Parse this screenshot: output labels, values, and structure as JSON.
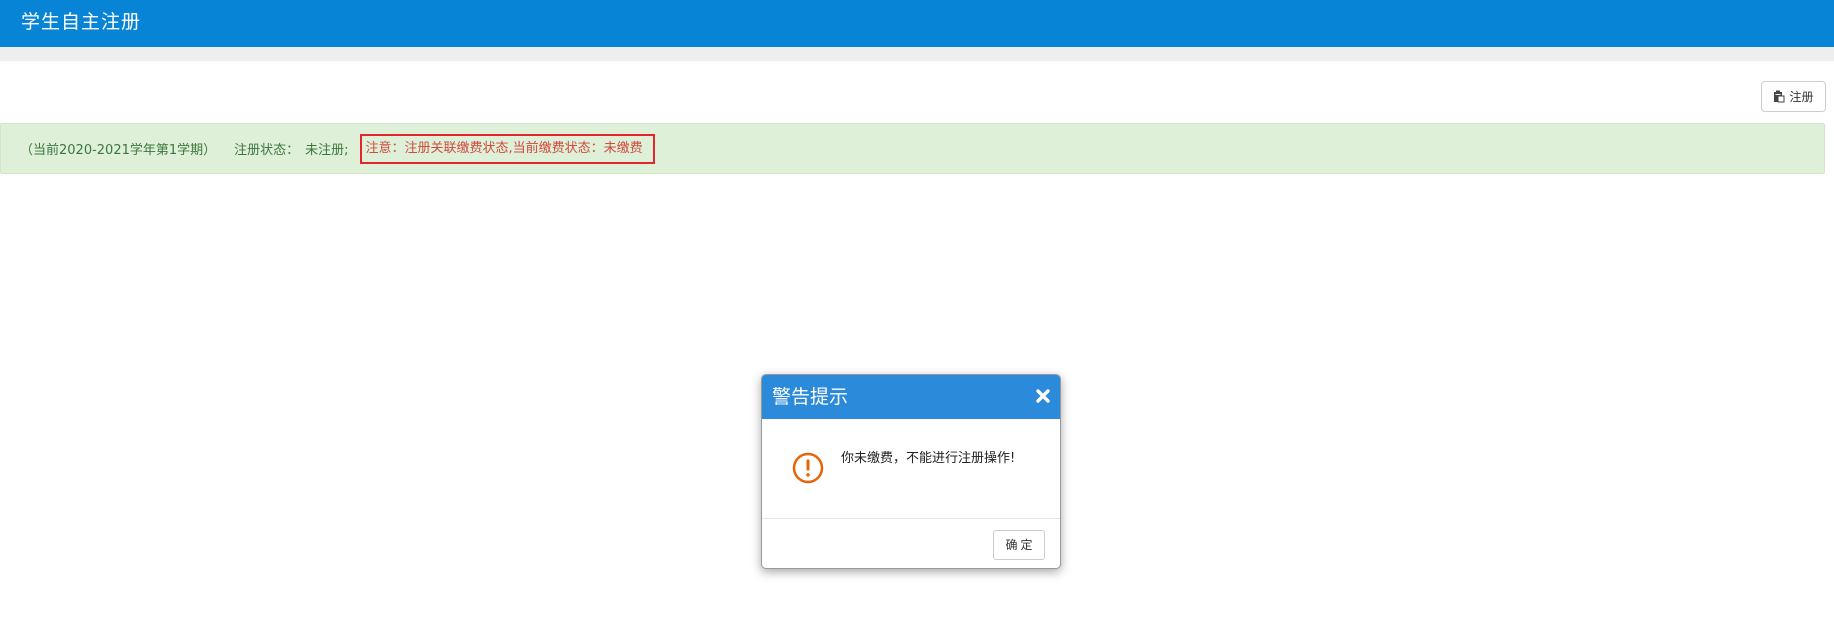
{
  "header": {
    "title": "学生自主注册",
    "bg_color": "#0784d5"
  },
  "toolbar": {
    "register_label": "注册",
    "register_icon": "clipboard-icon"
  },
  "status": {
    "term": "（当前2020-2021学年第1学期）",
    "state_label": "注册状态：",
    "state_value": "未注册;",
    "warning": "注意：注册关联缴费状态,当前缴费状态：未缴费",
    "bg_color": "#dff0d8",
    "warning_color": "#d04a3f",
    "highlight_border_color": "#e3262e"
  },
  "dialog": {
    "title": "警告提示",
    "message": "你未缴费，不能进行注册操作!",
    "ok_label": "确定",
    "header_color": "#2b8ad9",
    "icon": "warning-circle-icon",
    "icon_color": "#e8630a"
  }
}
